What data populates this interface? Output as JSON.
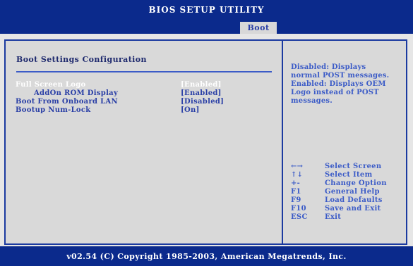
{
  "header": {
    "title": "BIOS SETUP UTILITY",
    "active_tab": "Boot"
  },
  "main": {
    "section_title": "Boot Settings Configuration",
    "options": [
      {
        "label": "Full Screen Logo",
        "value": "[Enabled]",
        "selected": true,
        "indent": false
      },
      {
        "label": "AddOn ROM Display",
        "value": "[Enabled]",
        "selected": false,
        "indent": true
      },
      {
        "label": "Boot From Onboard LAN",
        "value": "[Disabled]",
        "selected": false,
        "indent": false
      },
      {
        "label": "Bootup Num-Lock",
        "value": "[On]",
        "selected": false,
        "indent": false
      }
    ]
  },
  "help": {
    "lines": [
      "Disabled: Displays",
      "normal POST messages.",
      "Enabled: Displays OEM",
      "Logo instead of POST",
      "messages."
    ],
    "keys": [
      {
        "key": "←→",
        "desc": "Select Screen"
      },
      {
        "key": "↑↓",
        "desc": "Select Item"
      },
      {
        "key": "+-",
        "desc": "Change Option"
      },
      {
        "key": "F1",
        "desc": "General Help"
      },
      {
        "key": "F9",
        "desc": "Load Defaults"
      },
      {
        "key": "F10",
        "desc": "Save and Exit"
      },
      {
        "key": "ESC",
        "desc": "Exit"
      }
    ]
  },
  "footer": {
    "copyright": "v02.54 (C) Copyright 1985-2003, American Megatrends, Inc."
  },
  "colors": {
    "bar_blue": "#0b2a8c",
    "text_blue": "#2a3fa6",
    "panel_gray": "#d9d9d9",
    "selected_text": "#ffffff"
  }
}
